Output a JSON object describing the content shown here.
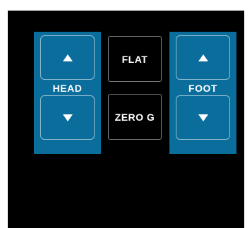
{
  "remote": {
    "head": {
      "label": "HEAD",
      "up_icon": "triangle-up-icon",
      "down_icon": "triangle-down-icon"
    },
    "foot": {
      "label": "FOOT",
      "up_icon": "triangle-up-icon",
      "down_icon": "triangle-down-icon"
    },
    "presets": [
      {
        "label": "FLAT"
      },
      {
        "label": "ZERO G"
      }
    ]
  },
  "colors": {
    "panel": "#0a6d9b",
    "background": "#000000",
    "text": "#ffffff"
  }
}
